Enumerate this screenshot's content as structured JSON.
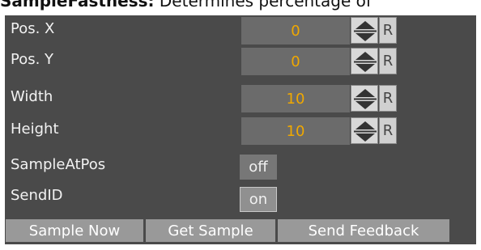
{
  "caption": {
    "lead": "SampleFastness:",
    "rest": " Determines percentage of"
  },
  "rows": [
    {
      "label": "Pos. X",
      "value": "0",
      "reset": "R"
    },
    {
      "label": "Pos. Y",
      "value": "0",
      "reset": "R"
    },
    {
      "label": "Width",
      "value": "10",
      "reset": "R"
    },
    {
      "label": "Height",
      "value": "10",
      "reset": "R"
    }
  ],
  "toggles": [
    {
      "label": "SampleAtPos",
      "state": "off"
    },
    {
      "label": "SendID",
      "state": "on"
    }
  ],
  "buttons": {
    "sample_now": "Sample Now",
    "get_sample": "Get Sample",
    "send_feedback": "Send Feedback"
  },
  "colors": {
    "panel_bg": "#4a4a4a",
    "value_text": "#f0a800",
    "label_text": "#f2f2f2",
    "button_bg": "#999999"
  },
  "icons": {
    "spinner": "up-down-arrows-icon"
  }
}
